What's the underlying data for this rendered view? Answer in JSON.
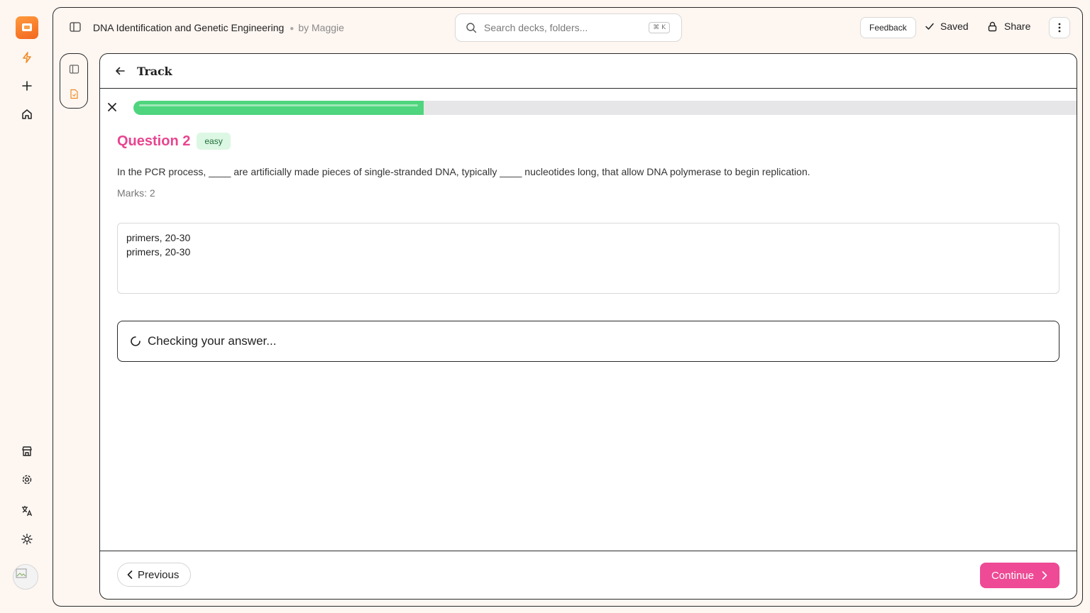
{
  "header": {
    "deck_title": "DNA Identification and Genetic Engineering",
    "author": "by Maggie",
    "search_placeholder": "Search decks, folders...",
    "search_shortcut": "⌘ K",
    "feedback_label": "Feedback",
    "saved_label": "Saved",
    "share_label": "Share"
  },
  "card": {
    "title": "Track",
    "progress": 0.307
  },
  "question": {
    "label": "Question 2",
    "difficulty": "easy",
    "text": "In the PCR process, ____ are artificially made pieces of single-stranded DNA, typically ____ nucleotides long, that allow DNA polymerase to begin replication.",
    "marks": "Marks: 2",
    "answer_value": "primers, 20-30\nprimers, 20-30",
    "status_text": "Checking your answer..."
  },
  "footer": {
    "previous_label": "Previous",
    "continue_label": "Continue"
  },
  "colors": {
    "accent_pink": "#ee4a95",
    "question_pink": "#e8458f",
    "progress_green": "#4fd57d",
    "logo_orange": "#f2661f"
  }
}
